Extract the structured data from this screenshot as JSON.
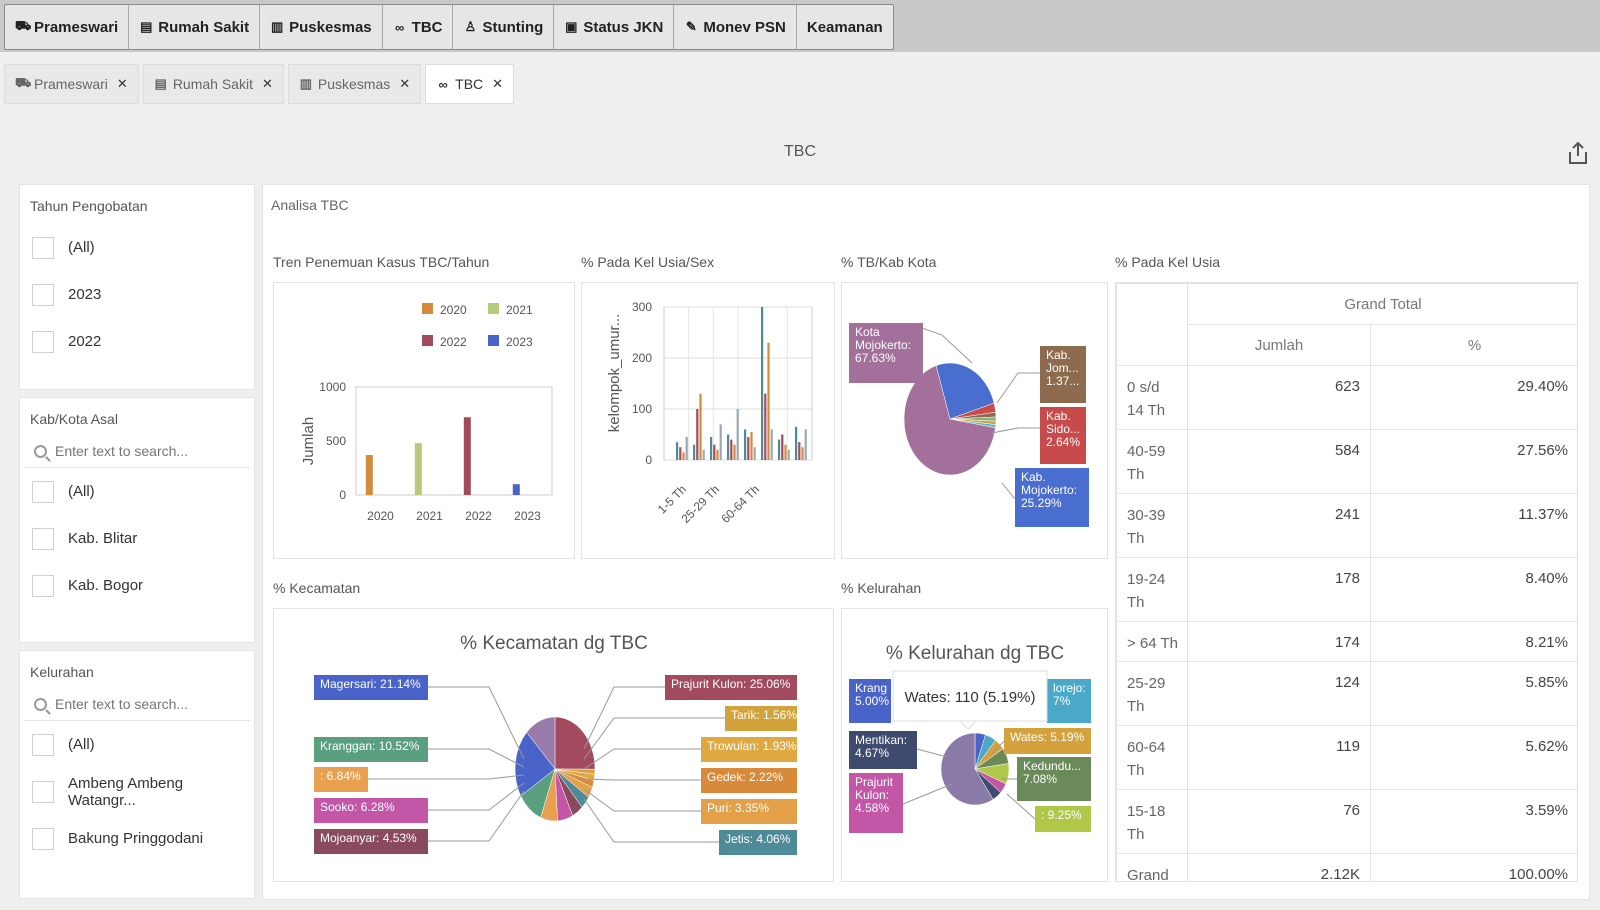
{
  "menu": {
    "items": [
      {
        "icon": "car-icon",
        "label": "Prameswari"
      },
      {
        "icon": "hospital-icon",
        "label": "Rumah Sakit"
      },
      {
        "icon": "building-icon",
        "label": "Puskesmas"
      },
      {
        "icon": "binoculars-icon",
        "label": "TBC"
      },
      {
        "icon": "child-icon",
        "label": "Stunting"
      },
      {
        "icon": "id-card-icon",
        "label": "Status JKN"
      },
      {
        "icon": "syringe-icon",
        "label": "Monev PSN"
      },
      {
        "icon": "",
        "label": "Keamanan"
      }
    ]
  },
  "tabs": [
    {
      "icon": "car-icon",
      "label": "Prameswari",
      "active": false
    },
    {
      "icon": "hospital-icon",
      "label": "Rumah Sakit",
      "active": false
    },
    {
      "icon": "building-icon",
      "label": "Puskesmas",
      "active": false
    },
    {
      "icon": "binoculars-icon",
      "label": "TBC",
      "active": true
    }
  ],
  "page": {
    "title": "TBC",
    "share_icon": "share-icon"
  },
  "filters": {
    "tahun": {
      "title": "Tahun Pengobatan",
      "items": [
        "(All)",
        "2023",
        "2022"
      ]
    },
    "kab": {
      "title": "Kab/Kota Asal",
      "placeholder": "Enter text to search...",
      "items": [
        "(All)",
        "Kab. Blitar",
        "Kab. Bogor"
      ]
    },
    "kel": {
      "title": "Kelurahan",
      "placeholder": "Enter text to search...",
      "items": [
        "(All)",
        "Ambeng Ambeng Watangr...",
        "Bakung Pringgodani"
      ]
    }
  },
  "main": {
    "title": "Analisa TBC"
  },
  "sections": {
    "tren": "Tren Penemuan Kasus TBC/Tahun",
    "usia_sex": "% Pada Kel Usia/Sex",
    "kab_kota": "% TB/Kab Kota",
    "kel_usia": "% Pada Kel Usia",
    "kecamatan": "% Kecamatan",
    "kelurahan": "% Kelurahan"
  },
  "colors": {
    "2020": "#d48a3c",
    "2021": "#b7c97b",
    "2022": "#a24b5e",
    "2023": "#4a63c8"
  },
  "chart_data": [
    {
      "id": "tren",
      "type": "bar",
      "categories": [
        "2020",
        "2021",
        "2022",
        "2023"
      ],
      "series": [
        {
          "name": "2020",
          "values": [
            370,
            0,
            0,
            0
          ]
        },
        {
          "name": "2021",
          "values": [
            0,
            480,
            0,
            0
          ]
        },
        {
          "name": "2022",
          "values": [
            0,
            0,
            720,
            0
          ]
        },
        {
          "name": "2023",
          "values": [
            0,
            0,
            0,
            100
          ]
        }
      ],
      "ylabel": "Jumlah",
      "ylim": [
        0,
        1000
      ],
      "yticks": [
        0,
        500,
        1000
      ],
      "grid": false,
      "legend": "top-right"
    },
    {
      "id": "usia_sex",
      "type": "bar",
      "ylabel": "kelompok_umur...",
      "ylim": [
        0,
        300
      ],
      "yticks": [
        0,
        100,
        200,
        300
      ],
      "xticks": [
        "1-5 Th",
        "25-29 Th",
        "60-64 Th"
      ],
      "grid": true,
      "groups": [
        [
          35,
          25,
          15,
          45
        ],
        [
          30,
          100,
          130,
          20
        ],
        [
          45,
          30,
          20,
          70
        ],
        [
          50,
          40,
          30,
          100
        ],
        [
          60,
          45,
          55,
          25
        ],
        [
          300,
          130,
          230,
          60
        ],
        [
          40,
          50,
          30,
          20
        ],
        [
          65,
          35,
          25,
          60
        ]
      ]
    },
    {
      "id": "kab_kota",
      "type": "pie",
      "slices": [
        {
          "label": "Kota Mojokerto: 67.63%",
          "value": 67.63,
          "color": "#a2709a"
        },
        {
          "label": "Kab. Mojokerto: 25.29%",
          "value": 25.29,
          "color": "#4a6ecf"
        },
        {
          "label": "Kab. Sido... 2.64%",
          "value": 2.64,
          "color": "#c94a4a"
        },
        {
          "label": "Kab. Jom... 1.37...",
          "value": 1.37,
          "color": "#8e6b4f"
        },
        {
          "label": "",
          "value": 1.2,
          "color": "#86b07a"
        },
        {
          "label": "",
          "value": 1.0,
          "color": "#d4a23c"
        },
        {
          "label": "",
          "value": 0.87,
          "color": "#6ab0c8"
        }
      ]
    },
    {
      "id": "kecamatan",
      "type": "pie",
      "title": "% Kecamatan dg TBC",
      "slices": [
        {
          "label": "Prajurit Kulon: 25.06%",
          "value": 25.06,
          "color": "#a24b5e"
        },
        {
          "label": "Tarik: 1.56%",
          "value": 1.56,
          "color": "#d4a23c"
        },
        {
          "label": "Trowulan: 1.93%",
          "value": 1.93,
          "color": "#e0a840"
        },
        {
          "label": "Gedek: 2.22%",
          "value": 2.22,
          "color": "#d88a3a"
        },
        {
          "label": "Puri: 3.35%",
          "value": 3.35,
          "color": "#e3a048"
        },
        {
          "label": "Jetis: 4.06%",
          "value": 4.06,
          "color": "#4f8a99"
        },
        {
          "label": "Mojoanyar: 4.53%",
          "value": 4.53,
          "color": "#8a4a5e"
        },
        {
          "label": "Sooko: 6.28%",
          "value": 6.28,
          "color": "#c456a8"
        },
        {
          "label": ": 6.84%",
          "value": 6.84,
          "color": "#e8a050"
        },
        {
          "label": "Kranggan: 10.52%",
          "value": 10.52,
          "color": "#5aa080"
        },
        {
          "label": "Magersari: 21.14%",
          "value": 21.14,
          "color": "#4a63c8"
        },
        {
          "label": "",
          "value": 12.51,
          "color": "#9a7aa8"
        }
      ]
    },
    {
      "id": "kelurahan",
      "type": "pie",
      "title": "% Kelurahan dg TBC",
      "tooltip": "Wates: 110 (5.19%)",
      "slices": [
        {
          "label": "Kranggan 5.00%",
          "value": 5.0,
          "color": "#4a63c8"
        },
        {
          "label": "...lorejo: ...7%",
          "value": 5.27,
          "color": "#4aa8c8"
        },
        {
          "label": "Wates: 5.19%",
          "value": 5.19,
          "color": "#d4a23c"
        },
        {
          "label": "Kedundu... 7.08%",
          "value": 7.08,
          "color": "#6a8a5a"
        },
        {
          "label": ": 9.25%",
          "value": 9.25,
          "color": "#b0c84a"
        },
        {
          "label": "Prajurit Kulon: 4.58%",
          "value": 4.58,
          "color": "#c456a8"
        },
        {
          "label": "Mentikan: 4.67%",
          "value": 4.67,
          "color": "#3e4a6e"
        },
        {
          "label": "",
          "value": 58.96,
          "color": "#8a7aa8"
        }
      ]
    }
  ],
  "pivot": {
    "header_group": "Grand Total",
    "columns": [
      "Jumlah",
      "%"
    ],
    "rows": [
      {
        "label": "0 s/d 14 Th",
        "jumlah": "623",
        "pct": "29.40%"
      },
      {
        "label": "40-59 Th",
        "jumlah": "584",
        "pct": "27.56%"
      },
      {
        "label": "30-39 Th",
        "jumlah": "241",
        "pct": "11.37%"
      },
      {
        "label": "19-24 Th",
        "jumlah": "178",
        "pct": "8.40%"
      },
      {
        "label": "> 64 Th",
        "jumlah": "174",
        "pct": "8.21%"
      },
      {
        "label": "25-29 Th",
        "jumlah": "124",
        "pct": "5.85%"
      },
      {
        "label": "60-64 Th",
        "jumlah": "119",
        "pct": "5.62%"
      },
      {
        "label": "15-18 Th",
        "jumlah": "76",
        "pct": "3.59%"
      },
      {
        "label": "Grand",
        "jumlah": "2.12K",
        "pct": "100.00%"
      }
    ]
  }
}
